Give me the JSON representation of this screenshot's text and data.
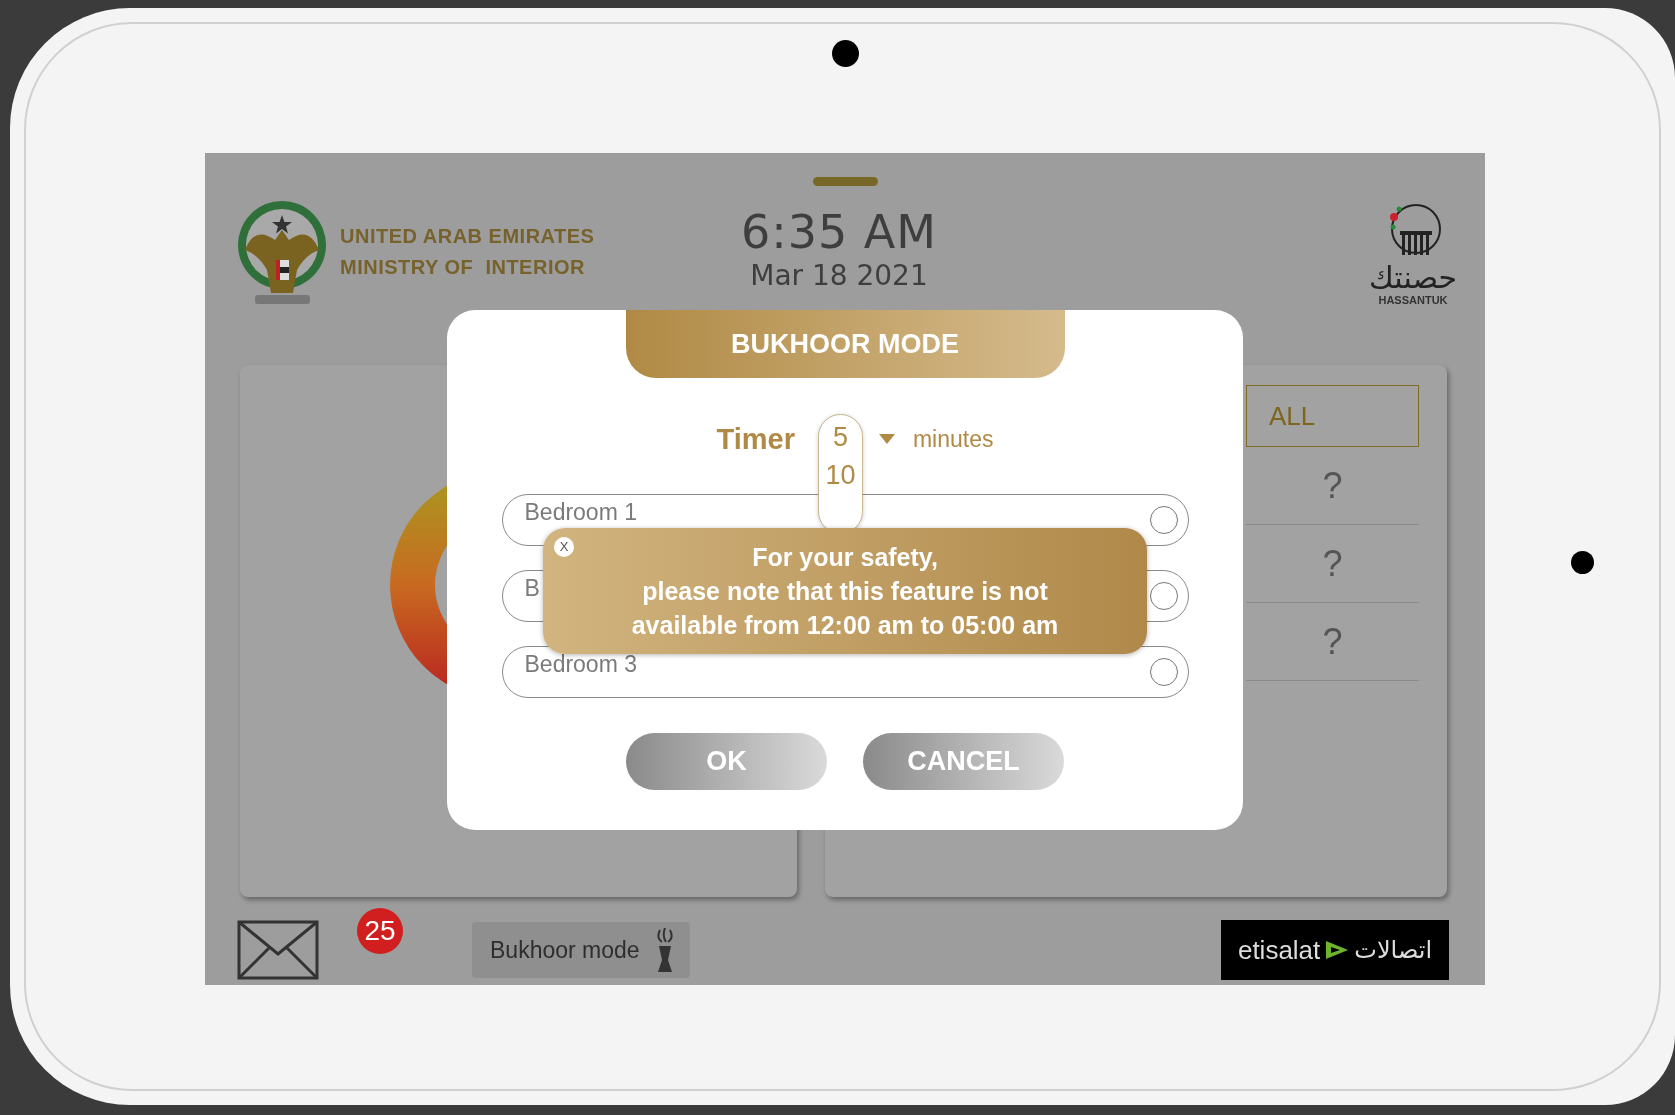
{
  "header": {
    "org_lines": [
      "UNITED ARAB EMIRATES",
      "MINISTRY OF  INTERIOR"
    ],
    "time": "6:35 AM",
    "date": "Mar 18 2021",
    "brand_arabic": "حصنتك",
    "brand": "HASSANTUK"
  },
  "right_panel": {
    "all_button": "ALL",
    "items": [
      "?",
      "?",
      "?"
    ]
  },
  "dialog": {
    "title": "BUKHOOR MODE",
    "timer_label": "Timer",
    "timer": {
      "value": "5",
      "options": [
        "10"
      ]
    },
    "unit": "minutes",
    "rooms": [
      {
        "label": "Bedroom 1",
        "selected": false
      },
      {
        "label": "B",
        "selected": false
      },
      {
        "label": "Bedroom 3",
        "selected": false
      }
    ],
    "buttons": [
      "OK",
      "CANCEL"
    ]
  },
  "toast": {
    "close": "X",
    "message": "For your safety,\nplease note that this feature is not\navailable from 12:00 am to 05:00 am"
  },
  "footer": {
    "unread_count": "25",
    "bukhoor_button": "Bukhoor mode",
    "operator_latin": "etisalat",
    "operator_arabic": "اتصالات"
  }
}
